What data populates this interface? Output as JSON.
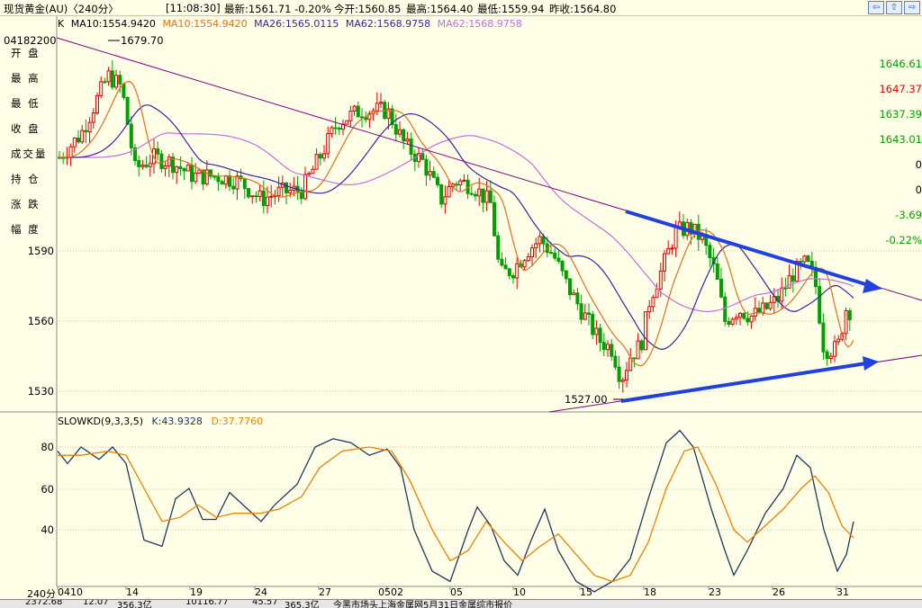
{
  "titlebar": {
    "name": "现货黄金(AU)〈240分〉",
    "time": "[11:08:30]",
    "last": "最新:1561.71 -0.20%",
    "open": "今开:1560.85",
    "high": "最高:1564.40",
    "low": "最低:1559.94",
    "prev": "昨收:1564.80",
    "buttons": [
      "⇦",
      "⇧",
      "⇨"
    ]
  },
  "ma_legend": {
    "k": "K",
    "ma10a": "MA10:1554.9420",
    "ma10b": "MA10:1554.9420",
    "ma26": "MA26:1565.0115",
    "ma62a": "MA62:1568.9758",
    "ma62b": "MA62:1568.9758"
  },
  "left_panel": {
    "code": "04182200",
    "open_label": "开 盘",
    "open_value": "1646.61",
    "high_label": "最 高",
    "high_value": "1647.37",
    "low_label": "最 低",
    "low_value": "1637.39",
    "close_label": "收 盘",
    "close_value": "1643.01",
    "volume_label": "成交量",
    "volume_value": "0",
    "position_label": "持 仓",
    "position_value": "0",
    "change_label": "涨 跌",
    "change_value": "-3.69",
    "range_label": "幅 度",
    "range_value": "-0.22%"
  },
  "price_axis": [
    "1590",
    "1560",
    "1530"
  ],
  "annotations": {
    "high_marker": "1679.70",
    "low_marker": "1527.00"
  },
  "kd_legend": {
    "title": "SLOWKD(9,3,3,5)",
    "k": "K:43.9328",
    "d": "D:37.7760"
  },
  "kd_axis": [
    "80",
    "60",
    "40"
  ],
  "x_axis": [
    "240分",
    "0410",
    "14",
    "19",
    "24",
    "27",
    "0502",
    "05",
    "10",
    "15",
    "18",
    "23",
    "26",
    "31"
  ],
  "statusbar": [
    "2372.68",
    "12.07",
    "356.3亿",
    "10116.77",
    "45.57",
    "365.3亿",
    "今黑市场头上海金属网5月31日金属综市报价"
  ],
  "colors": {
    "background": "#FFFFE8",
    "up_candle": "#00A000",
    "down_candle": "#E00000",
    "ma10": "#E07020",
    "ma26": "#4020A0",
    "ma62": "#C070E0",
    "trendline": "#800080",
    "arrow": "#2040E0",
    "k_line": "#203860",
    "d_line": "#F08000"
  }
}
